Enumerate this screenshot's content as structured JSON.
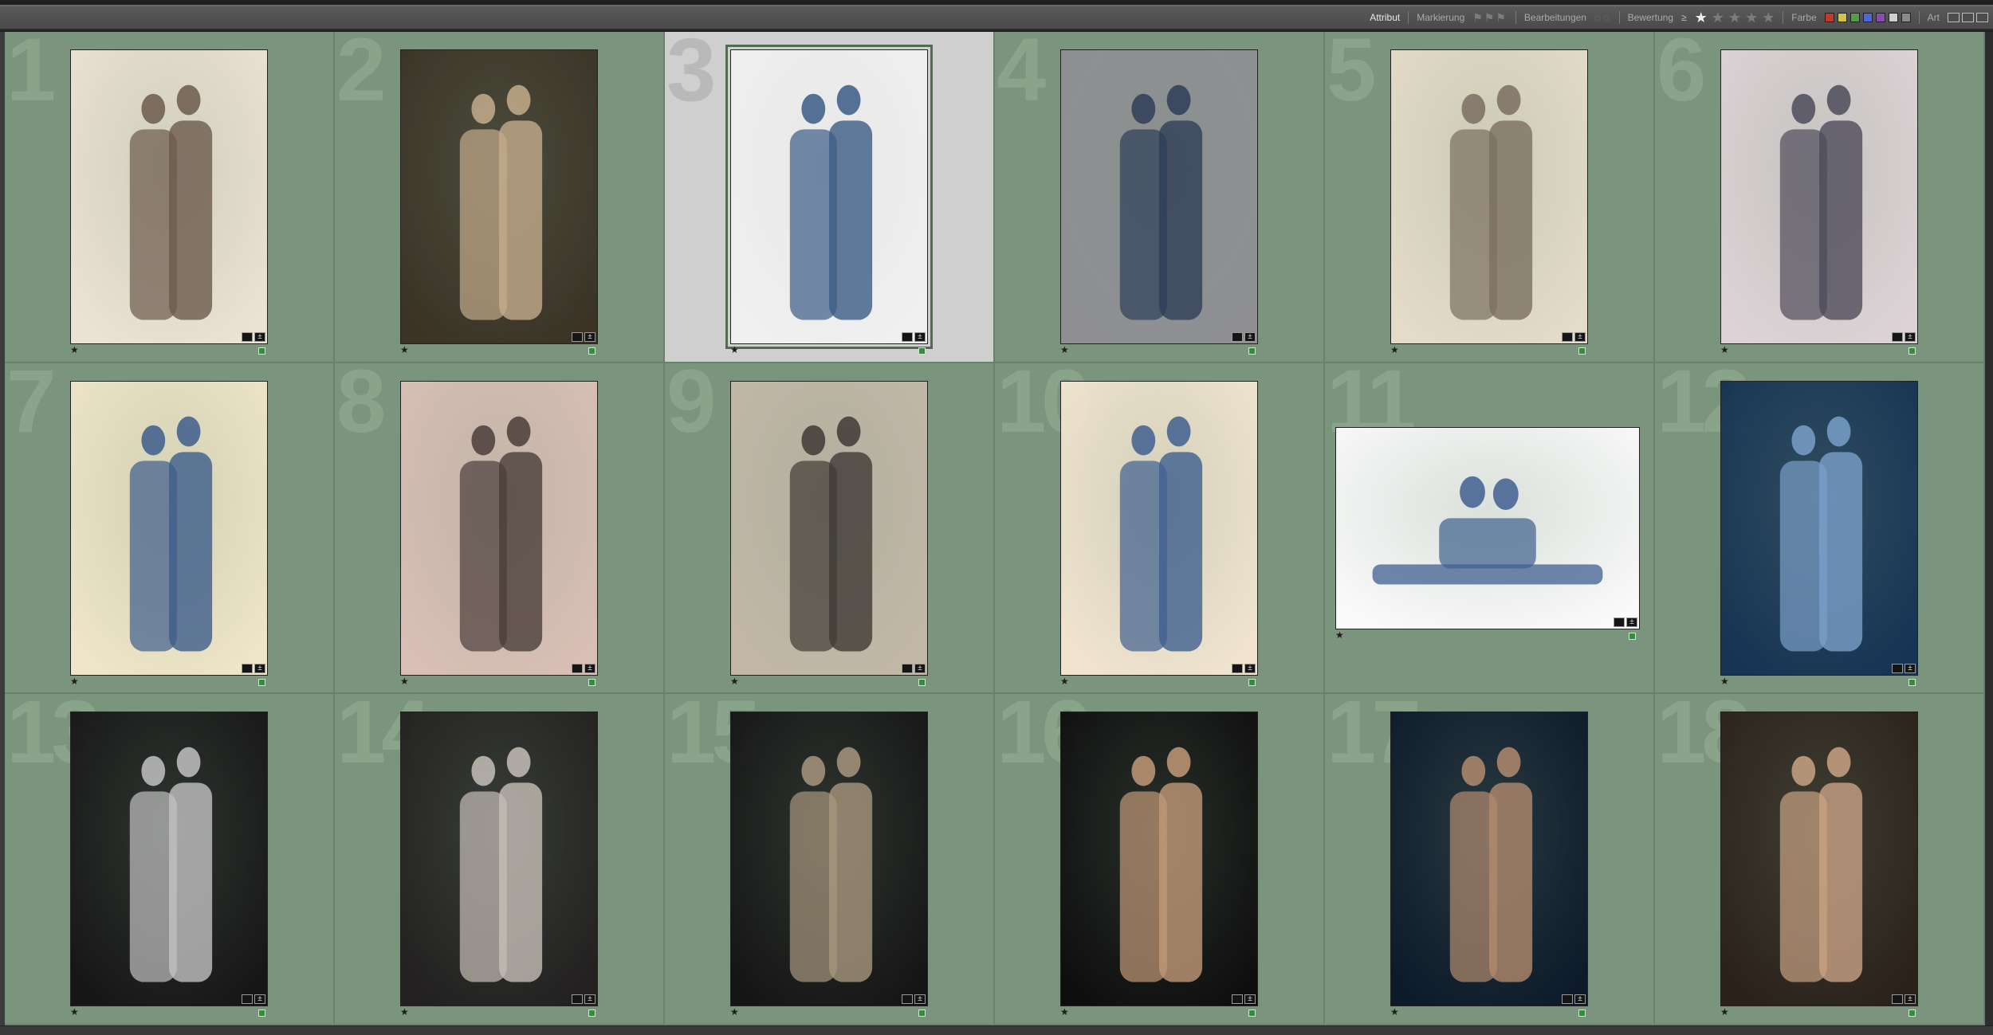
{
  "filter_bar": {
    "attribut": "Attribut",
    "markierung": "Markierung",
    "bearbeitungen": "Bearbeitungen",
    "bewertung": "Bewertung",
    "rating_operator": "≥",
    "rating_stars": 1,
    "farbe": "Farbe",
    "art": "Art",
    "colors": [
      "#c0392b",
      "#d4c24a",
      "#5a9a4a",
      "#4a6ad0",
      "#8a4ab0",
      "#d0d0d0",
      "#8a8a8a"
    ]
  },
  "thumbnails": [
    {
      "index": "1",
      "orientation": "portrait",
      "rating": "★",
      "selected": false,
      "bg": "#ece2d3",
      "fg": "#6b5a4c"
    },
    {
      "index": "2",
      "orientation": "portrait",
      "rating": "★",
      "selected": false,
      "bg": "#3a3326",
      "fg": "#c4ad8c"
    },
    {
      "index": "3",
      "orientation": "portrait",
      "rating": "★",
      "selected": true,
      "bg": "#f0f0f0",
      "fg": "#3b5b86"
    },
    {
      "index": "4",
      "orientation": "portrait",
      "rating": "★",
      "selected": false,
      "bg": "#8f8f93",
      "fg": "#2e3d58"
    },
    {
      "index": "5",
      "orientation": "portrait",
      "rating": "★",
      "selected": false,
      "bg": "#e4dcc8",
      "fg": "#7a6f60"
    },
    {
      "index": "6",
      "orientation": "portrait",
      "rating": "★",
      "selected": false,
      "bg": "#ddd3d6",
      "fg": "#4e4b5a"
    },
    {
      "index": "7",
      "orientation": "portrait",
      "rating": "★",
      "selected": false,
      "bg": "#efe5c8",
      "fg": "#3d5d8c"
    },
    {
      "index": "8",
      "orientation": "portrait",
      "rating": "★",
      "selected": false,
      "bg": "#d9bfb5",
      "fg": "#4a3d3a"
    },
    {
      "index": "9",
      "orientation": "portrait",
      "rating": "★",
      "selected": false,
      "bg": "#c3b8a8",
      "fg": "#3e3a35"
    },
    {
      "index": "10",
      "orientation": "portrait",
      "rating": "★",
      "selected": false,
      "bg": "#f1e4cf",
      "fg": "#3f5f8f"
    },
    {
      "index": "11",
      "orientation": "landscape",
      "rating": "★",
      "selected": false,
      "bg": "#fafafa",
      "fg": "#3f5f8f"
    },
    {
      "index": "12",
      "orientation": "portrait",
      "rating": "★",
      "selected": false,
      "bg": "#163454",
      "fg": "#7aa0c8"
    },
    {
      "index": "13",
      "orientation": "portrait",
      "rating": "★",
      "selected": false,
      "bg": "#161616",
      "fg": "#c2c2c2"
    },
    {
      "index": "14",
      "orientation": "portrait",
      "rating": "★",
      "selected": false,
      "bg": "#222020",
      "fg": "#c7bfb8"
    },
    {
      "index": "15",
      "orientation": "portrait",
      "rating": "★",
      "selected": false,
      "bg": "#151515",
      "fg": "#a8977e"
    },
    {
      "index": "16",
      "orientation": "portrait",
      "rating": "★",
      "selected": false,
      "bg": "#0e0e0e",
      "fg": "#c29a78"
    },
    {
      "index": "17",
      "orientation": "portrait",
      "rating": "★",
      "selected": false,
      "bg": "#0d1a2a",
      "fg": "#b38b6e"
    },
    {
      "index": "18",
      "orientation": "portrait",
      "rating": "★",
      "selected": false,
      "bg": "#2a211a",
      "fg": "#c9a384"
    }
  ]
}
